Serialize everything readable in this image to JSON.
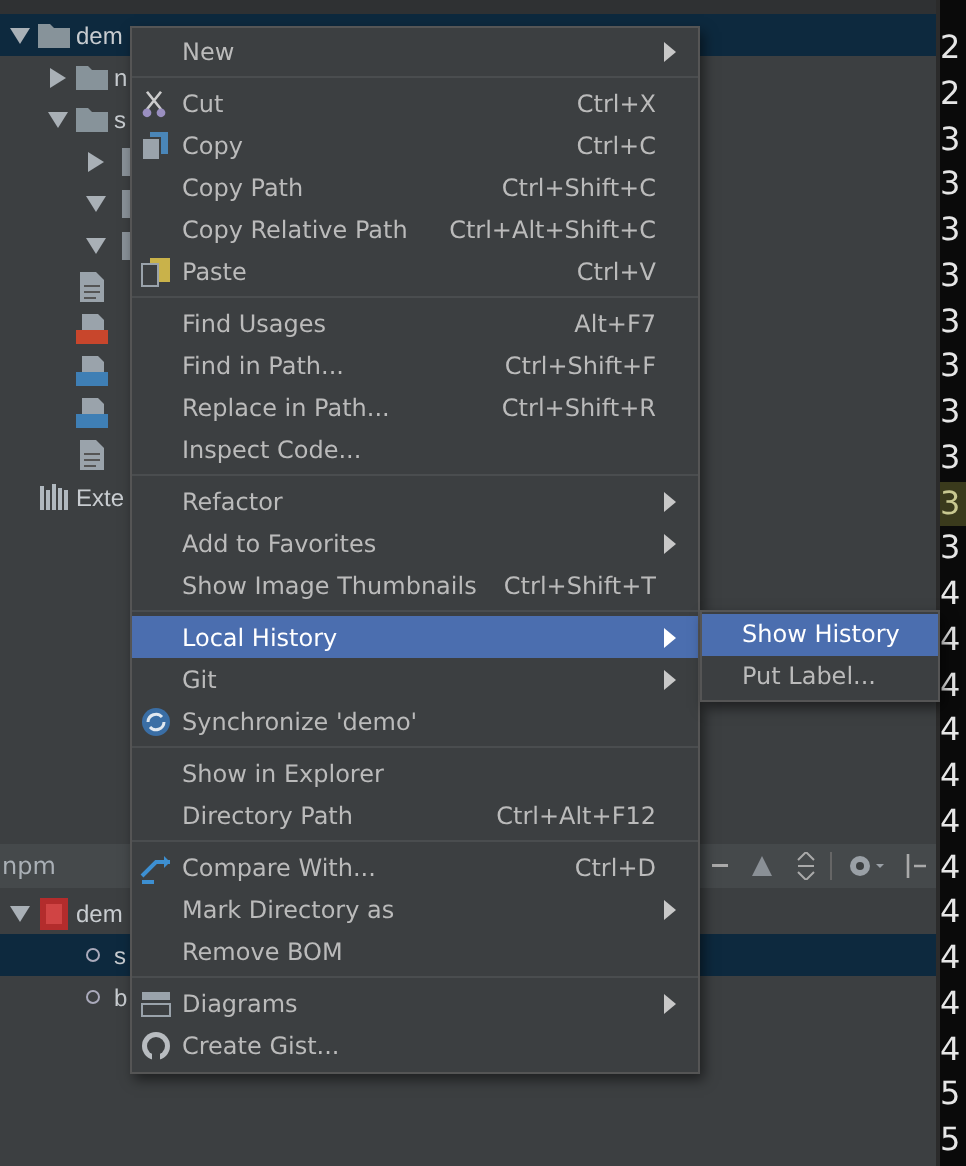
{
  "project_tree": [
    {
      "label": "dem",
      "kind": "folder",
      "expanded": true,
      "selected": true,
      "children": [
        {
          "label": "n",
          "kind": "folder",
          "expanded": false,
          "selected": false
        },
        {
          "label": "s",
          "kind": "folder",
          "expanded": true,
          "selected": false,
          "children": [
            {
              "kind": "package",
              "expanded": false,
              "selected": false
            },
            {
              "kind": "package",
              "expanded": true,
              "selected": false
            },
            {
              "kind": "package",
              "expanded": true,
              "selected": false
            }
          ]
        },
        {
          "kind": "file",
          "selected": false
        },
        {
          "kind": "archive",
          "selected": false
        },
        {
          "kind": "image",
          "selected": false
        },
        {
          "kind": "image",
          "selected": false
        },
        {
          "kind": "file",
          "selected": false
        }
      ]
    },
    {
      "label": "Exte",
      "kind": "libraries",
      "selected": false
    }
  ],
  "npm_panel": {
    "title": "npm",
    "tree": [
      {
        "label": "dem",
        "kind": "package-json",
        "expanded": true,
        "selected": false,
        "children": [
          {
            "label": "s",
            "kind": "script",
            "selected": true
          },
          {
            "label": "b",
            "kind": "script",
            "selected": false
          }
        ]
      }
    ]
  },
  "context_menu": {
    "groups": [
      [
        {
          "label": "New",
          "kind": "plain",
          "submenu": true,
          "selected": false
        }
      ],
      [
        {
          "label": "Cut",
          "shortcut": "Ctrl+X",
          "kind": "cut",
          "submenu": false,
          "selected": false
        },
        {
          "label": "Copy",
          "shortcut": "Ctrl+C",
          "kind": "copy",
          "submenu": false,
          "selected": false
        },
        {
          "label": "Copy Path",
          "shortcut": "Ctrl+Shift+C",
          "kind": "plain",
          "submenu": false,
          "selected": false
        },
        {
          "label": "Copy Relative Path",
          "shortcut": "Ctrl+Alt+Shift+C",
          "kind": "plain",
          "submenu": false,
          "selected": false
        },
        {
          "label": "Paste",
          "shortcut": "Ctrl+V",
          "kind": "paste",
          "submenu": false,
          "selected": false
        }
      ],
      [
        {
          "label": "Find Usages",
          "shortcut": "Alt+F7",
          "kind": "plain",
          "submenu": false,
          "selected": false
        },
        {
          "label": "Find in Path...",
          "shortcut": "Ctrl+Shift+F",
          "kind": "plain",
          "submenu": false,
          "selected": false
        },
        {
          "label": "Replace in Path...",
          "shortcut": "Ctrl+Shift+R",
          "kind": "plain",
          "submenu": false,
          "selected": false
        },
        {
          "label": "Inspect Code...",
          "kind": "plain",
          "submenu": false,
          "selected": false
        }
      ],
      [
        {
          "label": "Refactor",
          "kind": "plain",
          "submenu": true,
          "selected": false
        },
        {
          "label": "Add to Favorites",
          "kind": "plain",
          "submenu": true,
          "selected": false
        },
        {
          "label": "Show Image Thumbnails",
          "shortcut": "Ctrl+Shift+T",
          "kind": "plain",
          "submenu": false,
          "selected": false
        }
      ],
      [
        {
          "label": "Local History",
          "kind": "plain",
          "submenu": true,
          "selected": true
        },
        {
          "label": "Git",
          "kind": "plain",
          "submenu": true,
          "selected": false
        },
        {
          "label": "Synchronize 'demo'",
          "kind": "sync",
          "submenu": false,
          "selected": false
        }
      ],
      [
        {
          "label": "Show in Explorer",
          "kind": "plain",
          "submenu": false,
          "selected": false
        },
        {
          "label": "Directory Path",
          "shortcut": "Ctrl+Alt+F12",
          "kind": "plain",
          "submenu": false,
          "selected": false
        }
      ],
      [
        {
          "label": "Compare With...",
          "shortcut": "Ctrl+D",
          "kind": "compare",
          "submenu": false,
          "selected": false
        },
        {
          "label": "Mark Directory as",
          "kind": "plain",
          "submenu": true,
          "selected": false
        },
        {
          "label": "Remove BOM",
          "kind": "plain",
          "submenu": false,
          "selected": false
        }
      ],
      [
        {
          "label": "Diagrams",
          "kind": "diagram",
          "submenu": true,
          "selected": false
        },
        {
          "label": "Create Gist...",
          "kind": "github",
          "submenu": false,
          "selected": false
        }
      ]
    ]
  },
  "submenu": {
    "items": [
      {
        "label": "Show History",
        "selected": true
      },
      {
        "label": "Put Label...",
        "selected": false
      }
    ]
  },
  "gutter": {
    "lines": [
      {
        "text": "2",
        "current": false
      },
      {
        "text": "2",
        "current": false
      },
      {
        "text": "3",
        "current": false
      },
      {
        "text": "3",
        "current": false
      },
      {
        "text": "3",
        "current": false
      },
      {
        "text": "3",
        "current": false
      },
      {
        "text": "3",
        "current": false
      },
      {
        "text": "3",
        "current": false
      },
      {
        "text": "3",
        "current": false
      },
      {
        "text": "3",
        "current": false
      },
      {
        "text": "3",
        "current": true
      },
      {
        "text": "3",
        "current": false
      },
      {
        "text": "4",
        "current": false
      },
      {
        "text": "4",
        "current": false
      },
      {
        "text": "4",
        "current": false
      },
      {
        "text": "4",
        "current": false
      },
      {
        "text": "4",
        "current": false
      },
      {
        "text": "4",
        "current": false
      },
      {
        "text": "4",
        "current": false
      },
      {
        "text": "4",
        "current": false
      },
      {
        "text": "4",
        "current": false
      },
      {
        "text": "4",
        "current": false
      },
      {
        "text": "4",
        "current": false
      },
      {
        "text": "5",
        "current": false
      },
      {
        "text": "5",
        "current": false
      }
    ]
  }
}
